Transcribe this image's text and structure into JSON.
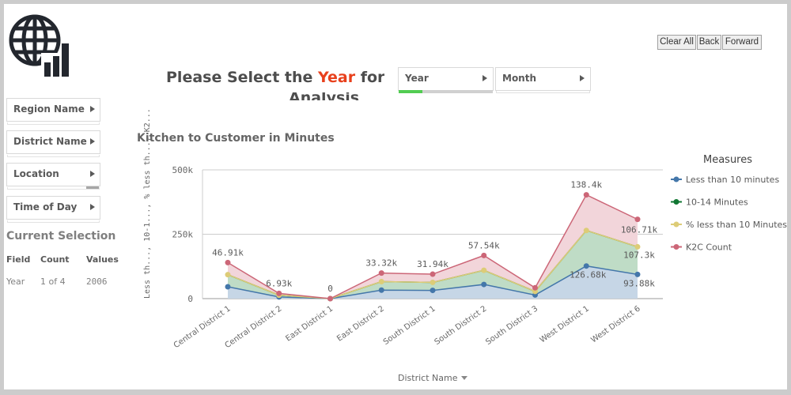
{
  "navigation": {
    "clear_all": "Clear All",
    "back": "Back",
    "forward": "Forward"
  },
  "logo": {
    "icon": "globe-chart-icon"
  },
  "sidebar": {
    "filters": [
      {
        "label": "Region Name"
      },
      {
        "label": "District Name"
      },
      {
        "label": "Location"
      },
      {
        "label": "Time of Day"
      }
    ],
    "current_selection": {
      "title": "Current Selection",
      "headers": [
        "Field",
        "Count",
        "Values"
      ],
      "rows": [
        [
          "Year",
          "1 of 4",
          "2006"
        ]
      ]
    }
  },
  "heading": {
    "prefix": "Please Select the ",
    "highlight": "Year",
    "suffix": " for",
    "line2": "Analysis",
    "highlight_color": "#e8401c"
  },
  "listboxes": [
    {
      "label": "Year",
      "selected_fraction": 0.25,
      "selected_color": "#52cc52"
    },
    {
      "label": "Month"
    }
  ],
  "chart_data": {
    "type": "area",
    "stacked": true,
    "title": "Kitchen to Customer in Minutes",
    "xlabel": "District Name",
    "ylabel": "Less th..., 10-1..., % less th..., K2...",
    "ylim": [
      0,
      500000
    ],
    "yticks": [
      0,
      250000,
      500000
    ],
    "ytick_labels": [
      "0",
      "250k",
      "500k"
    ],
    "grid": true,
    "legend_title": "Measures",
    "legend_position": "right",
    "categories": [
      "Central District 1",
      "Central District 2",
      "East District 1",
      "East District 2",
      "South District 1",
      "South District 2",
      "South District 3",
      "West District 1",
      "West District 6"
    ],
    "series": [
      {
        "name": "Less than 10 minutes",
        "color": "#4477aa",
        "fill": "#c6d6e6",
        "values": [
          46000,
          6500,
          0,
          33000,
          32000,
          55000,
          14000,
          126680,
          93880
        ]
      },
      {
        "name": "10-14 Minutes",
        "color": "#117733",
        "fill": "#bfdcc6",
        "values": [
          47000,
          7000,
          0,
          33000,
          31000,
          55000,
          14000,
          138000,
          107300
        ]
      },
      {
        "name": "% less than 10 Minutes",
        "color": "#ddcc77",
        "fill": "#bfdcc6",
        "values": [
          1,
          1,
          0,
          1,
          1,
          1,
          1,
          1,
          1
        ]
      },
      {
        "name": "K2C Count",
        "color": "#cc6677",
        "fill": "#f2d5da",
        "values": [
          46910,
          6930,
          0,
          33320,
          31940,
          57540,
          14000,
          138400,
          106710
        ]
      }
    ],
    "data_labels": [
      {
        "category": "Central District 1",
        "series": "K2C Count",
        "text": "46.91k"
      },
      {
        "category": "Central District 2",
        "series": "K2C Count",
        "text": "6.93k"
      },
      {
        "category": "East District 1",
        "series": "K2C Count",
        "text": "0"
      },
      {
        "category": "East District 2",
        "series": "K2C Count",
        "text": "33.32k"
      },
      {
        "category": "South District 1",
        "series": "K2C Count",
        "text": "31.94k"
      },
      {
        "category": "South District 2",
        "series": "K2C Count",
        "text": "57.54k"
      },
      {
        "category": "West District 1",
        "series": "K2C Count",
        "text": "138.4k"
      },
      {
        "category": "West District 6",
        "series": "K2C Count",
        "text": "106.71k"
      },
      {
        "category": "West District 6",
        "series": "10-14 Minutes",
        "text": "107.3k"
      },
      {
        "category": "West District 1",
        "series": "Less than 10 minutes",
        "text": "126.68k"
      },
      {
        "category": "West District 6",
        "series": "Less than 10 minutes",
        "text": "93.88k"
      }
    ]
  }
}
